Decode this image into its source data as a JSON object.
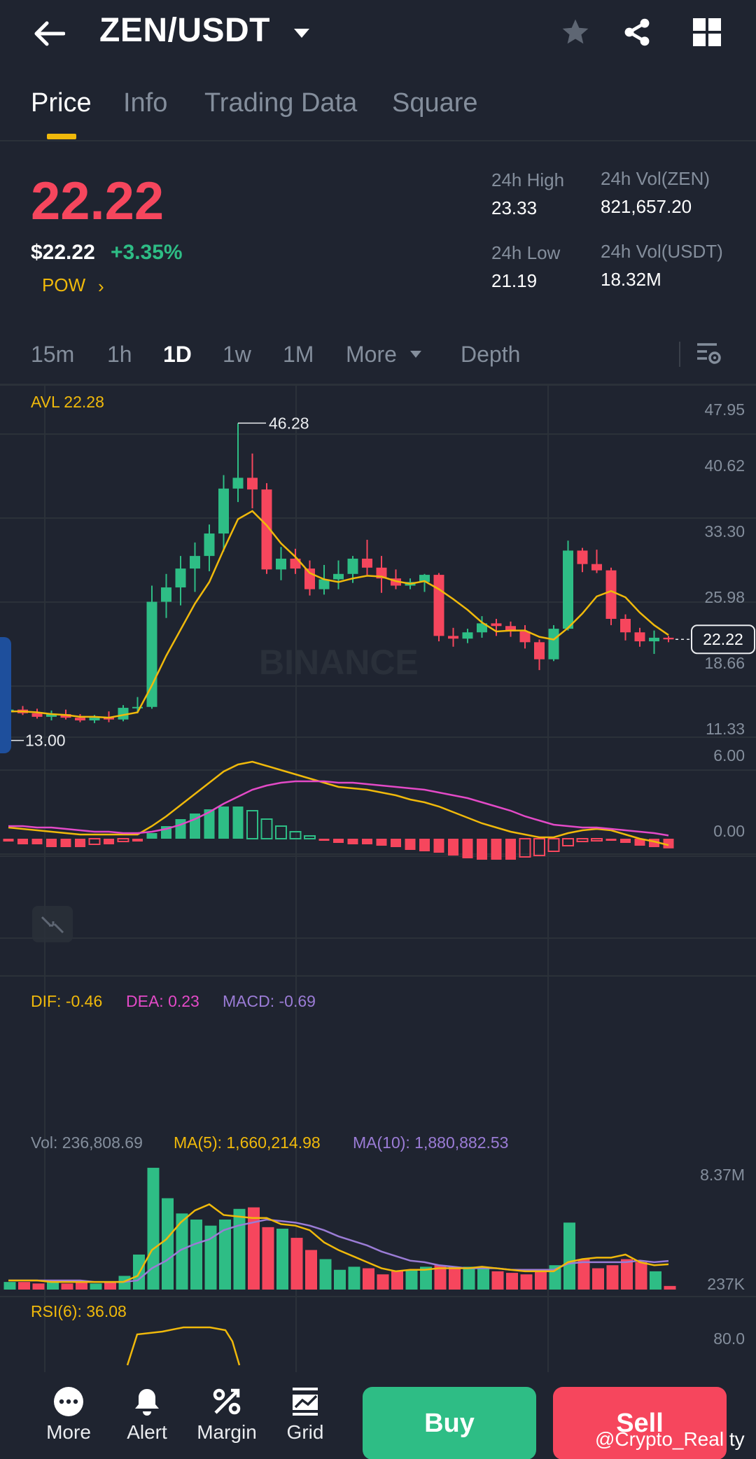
{
  "header": {
    "pair": "ZEN/USDT"
  },
  "tabs": [
    "Price",
    "Info",
    "Trading Data",
    "Square"
  ],
  "price": {
    "last": "22.22",
    "usd": "$22.22",
    "change_pct": "+3.35%",
    "tag": "POW",
    "high_label": "24h High",
    "high": "23.33",
    "low_label": "24h Low",
    "low": "21.19",
    "vol_base_label": "24h Vol(ZEN)",
    "vol_base": "821,657.20",
    "vol_quote_label": "24h Vol(USDT)",
    "vol_quote": "18.32M"
  },
  "intervals": [
    "15m",
    "1h",
    "1D",
    "1w",
    "1M",
    "More",
    "Depth"
  ],
  "chart": {
    "avl_label": "AVL 22.28",
    "y_ticks": [
      "47.95",
      "40.62",
      "33.30",
      "25.98",
      "18.66",
      "11.33"
    ],
    "max_label": "46.28",
    "min_label": "13.00",
    "current_label": "22.22",
    "watermark": "BINANCE",
    "macd": {
      "dif": "DIF: -0.46",
      "dea": "DEA: 0.23",
      "macd": "MACD: -0.69",
      "y_top": "6.00",
      "y_zero": "0.00"
    },
    "vol": {
      "vol": "Vol: 236,808.69",
      "ma5": "MA(5): 1,660,214.98",
      "ma10": "MA(10): 1,880,882.53",
      "y_top": "8.37M",
      "y_bottom": "237K"
    },
    "rsi": {
      "label": "RSI(6): 36.08",
      "y_top": "80.0"
    }
  },
  "chart_data": {
    "type": "candlestick",
    "ylim": [
      11.33,
      47.95
    ],
    "y_ticks": [
      47.95,
      40.62,
      33.3,
      25.98,
      18.66,
      11.33
    ],
    "candles": [
      {
        "o": 14.1,
        "h": 14.6,
        "l": 13.6,
        "c": 14.4
      },
      {
        "o": 14.4,
        "h": 14.8,
        "l": 13.8,
        "c": 14.0
      },
      {
        "o": 14.0,
        "h": 14.5,
        "l": 13.4,
        "c": 13.6
      },
      {
        "o": 13.6,
        "h": 14.3,
        "l": 13.2,
        "c": 13.9
      },
      {
        "o": 13.9,
        "h": 14.4,
        "l": 13.3,
        "c": 13.5
      },
      {
        "o": 13.5,
        "h": 13.9,
        "l": 13.0,
        "c": 13.2
      },
      {
        "o": 13.2,
        "h": 13.8,
        "l": 12.9,
        "c": 13.5
      },
      {
        "o": 13.5,
        "h": 14.2,
        "l": 13.0,
        "c": 13.3
      },
      {
        "o": 13.3,
        "h": 14.9,
        "l": 13.1,
        "c": 14.6
      },
      {
        "o": 14.6,
        "h": 15.8,
        "l": 14.0,
        "c": 14.7
      },
      {
        "o": 14.7,
        "h": 28.2,
        "l": 14.5,
        "c": 26.4
      },
      {
        "o": 26.4,
        "h": 29.5,
        "l": 24.6,
        "c": 28.0
      },
      {
        "o": 28.0,
        "h": 31.5,
        "l": 26.0,
        "c": 30.1
      },
      {
        "o": 30.1,
        "h": 33.0,
        "l": 27.5,
        "c": 31.5
      },
      {
        "o": 31.5,
        "h": 35.0,
        "l": 29.8,
        "c": 34.0
      },
      {
        "o": 34.0,
        "h": 40.5,
        "l": 32.0,
        "c": 39.0
      },
      {
        "o": 39.0,
        "h": 46.28,
        "l": 37.5,
        "c": 40.2
      },
      {
        "o": 40.2,
        "h": 42.9,
        "l": 36.8,
        "c": 38.9
      },
      {
        "o": 38.9,
        "h": 39.6,
        "l": 29.5,
        "c": 30.0
      },
      {
        "o": 30.0,
        "h": 32.5,
        "l": 28.8,
        "c": 31.2
      },
      {
        "o": 31.2,
        "h": 32.3,
        "l": 29.5,
        "c": 30.1
      },
      {
        "o": 30.1,
        "h": 31.0,
        "l": 27.1,
        "c": 27.8
      },
      {
        "o": 27.8,
        "h": 30.5,
        "l": 27.2,
        "c": 28.9
      },
      {
        "o": 28.9,
        "h": 31.0,
        "l": 27.8,
        "c": 29.5
      },
      {
        "o": 29.5,
        "h": 31.5,
        "l": 28.5,
        "c": 31.2
      },
      {
        "o": 31.2,
        "h": 33.3,
        "l": 29.4,
        "c": 30.2
      },
      {
        "o": 30.2,
        "h": 31.5,
        "l": 27.4,
        "c": 29.0
      },
      {
        "o": 29.0,
        "h": 30.0,
        "l": 27.8,
        "c": 28.2
      },
      {
        "o": 28.2,
        "h": 29.0,
        "l": 27.8,
        "c": 28.6
      },
      {
        "o": 28.6,
        "h": 29.5,
        "l": 27.5,
        "c": 29.4
      },
      {
        "o": 29.4,
        "h": 29.6,
        "l": 22.0,
        "c": 22.6
      },
      {
        "o": 22.6,
        "h": 23.5,
        "l": 21.4,
        "c": 22.3
      },
      {
        "o": 22.3,
        "h": 23.4,
        "l": 21.8,
        "c": 23.0
      },
      {
        "o": 23.0,
        "h": 24.8,
        "l": 22.4,
        "c": 24.0
      },
      {
        "o": 24.0,
        "h": 24.5,
        "l": 22.6,
        "c": 23.7
      },
      {
        "o": 23.7,
        "h": 24.2,
        "l": 22.5,
        "c": 23.1
      },
      {
        "o": 23.1,
        "h": 23.8,
        "l": 21.2,
        "c": 21.9
      },
      {
        "o": 21.9,
        "h": 22.2,
        "l": 18.8,
        "c": 20.0
      },
      {
        "o": 20.0,
        "h": 23.8,
        "l": 19.8,
        "c": 23.4
      },
      {
        "o": 23.4,
        "h": 33.2,
        "l": 23.2,
        "c": 32.1
      },
      {
        "o": 32.1,
        "h": 32.4,
        "l": 29.7,
        "c": 30.6
      },
      {
        "o": 30.6,
        "h": 32.2,
        "l": 29.6,
        "c": 29.9
      },
      {
        "o": 29.9,
        "h": 30.2,
        "l": 23.8,
        "c": 24.5
      },
      {
        "o": 24.5,
        "h": 25.0,
        "l": 22.1,
        "c": 23.0
      },
      {
        "o": 23.0,
        "h": 23.5,
        "l": 21.4,
        "c": 22.0
      },
      {
        "o": 22.0,
        "h": 23.2,
        "l": 20.6,
        "c": 22.4
      },
      {
        "o": 22.4,
        "h": 22.6,
        "l": 21.9,
        "c": 22.22
      }
    ],
    "ma_line": [
      14.2,
      14.2,
      14.1,
      13.9,
      13.8,
      13.6,
      13.6,
      13.5,
      13.8,
      14.1,
      17.1,
      20.4,
      23.3,
      26.2,
      28.6,
      32.2,
      35.6,
      36.5,
      34.9,
      32.9,
      31.4,
      29.6,
      28.9,
      28.6,
      29.0,
      29.3,
      29.2,
      28.7,
      28.4,
      28.7,
      27.8,
      26.7,
      25.5,
      24.1,
      23.1,
      23.2,
      23.2,
      22.5,
      22.2,
      23.5,
      25.1,
      27.0,
      27.6,
      26.9,
      25.2,
      23.8,
      22.7
    ],
    "macd": {
      "ylim": [
        -2.0,
        6.0
      ],
      "dif": [
        0.8,
        0.7,
        0.6,
        0.5,
        0.4,
        0.3,
        0.3,
        0.3,
        0.3,
        0.3,
        0.9,
        1.6,
        2.4,
        3.2,
        4.0,
        4.8,
        5.3,
        5.5,
        5.2,
        4.9,
        4.6,
        4.3,
        4.0,
        3.7,
        3.6,
        3.5,
        3.3,
        3.1,
        2.8,
        2.6,
        2.3,
        1.9,
        1.5,
        1.1,
        0.8,
        0.5,
        0.3,
        0.1,
        0.1,
        0.4,
        0.6,
        0.7,
        0.6,
        0.3,
        0.0,
        -0.2,
        -0.46
      ],
      "dea": [
        0.9,
        0.9,
        0.8,
        0.8,
        0.7,
        0.6,
        0.5,
        0.5,
        0.4,
        0.4,
        0.5,
        0.7,
        1.0,
        1.4,
        1.9,
        2.5,
        3.0,
        3.5,
        3.8,
        4.0,
        4.1,
        4.1,
        4.1,
        4.0,
        4.0,
        3.9,
        3.8,
        3.7,
        3.6,
        3.5,
        3.3,
        3.1,
        2.9,
        2.6,
        2.3,
        2.0,
        1.6,
        1.3,
        1.0,
        0.9,
        0.8,
        0.8,
        0.7,
        0.6,
        0.5,
        0.4,
        0.23
      ],
      "hist": [
        -0.2,
        -0.4,
        -0.4,
        -0.6,
        -0.6,
        -0.6,
        -0.4,
        -0.4,
        -0.2,
        -0.2,
        0.4,
        0.9,
        1.4,
        1.8,
        2.1,
        2.3,
        2.3,
        2.0,
        1.4,
        0.9,
        0.5,
        0.2,
        -0.1,
        -0.3,
        -0.4,
        -0.4,
        -0.5,
        -0.6,
        -0.8,
        -0.9,
        -1.0,
        -1.2,
        -1.4,
        -1.5,
        -1.5,
        -1.5,
        -1.3,
        -1.2,
        -0.9,
        -0.5,
        -0.2,
        -0.1,
        -0.1,
        -0.3,
        -0.5,
        -0.6,
        -0.69
      ]
    },
    "volume": {
      "ylim": [
        0,
        8.37
      ],
      "values": [
        0.5,
        0.5,
        0.4,
        0.5,
        0.4,
        0.5,
        0.4,
        0.5,
        0.9,
        2.3,
        8.0,
        6.0,
        5.0,
        4.6,
        4.2,
        4.6,
        5.3,
        5.4,
        4.1,
        4.0,
        3.4,
        2.6,
        2.0,
        1.3,
        1.5,
        1.4,
        1.0,
        1.2,
        1.3,
        1.5,
        1.6,
        1.5,
        1.5,
        1.4,
        1.2,
        1.1,
        1.0,
        1.3,
        1.6,
        4.4,
        2.0,
        1.4,
        1.6,
        2.0,
        1.8,
        1.2,
        0.237
      ],
      "ma5": [
        0.6,
        0.6,
        0.6,
        0.5,
        0.5,
        0.5,
        0.5,
        0.5,
        0.5,
        0.9,
        2.6,
        3.3,
        4.4,
        5.2,
        5.6,
        4.9,
        4.8,
        4.7,
        4.7,
        4.3,
        4.2,
        3.9,
        3.1,
        2.6,
        2.2,
        1.8,
        1.4,
        1.2,
        1.3,
        1.3,
        1.4,
        1.4,
        1.4,
        1.5,
        1.4,
        1.3,
        1.2,
        1.2,
        1.2,
        1.8,
        2.0,
        2.1,
        2.1,
        2.3,
        1.8,
        1.6,
        1.66
      ],
      "ma10": [
        0.6,
        0.6,
        0.6,
        0.6,
        0.6,
        0.6,
        0.5,
        0.5,
        0.5,
        0.6,
        1.4,
        1.9,
        2.6,
        3.0,
        3.3,
        3.9,
        4.2,
        4.4,
        4.6,
        4.5,
        4.4,
        4.2,
        3.9,
        3.5,
        3.2,
        2.9,
        2.5,
        2.2,
        1.9,
        1.8,
        1.6,
        1.5,
        1.4,
        1.4,
        1.4,
        1.3,
        1.3,
        1.3,
        1.3,
        1.7,
        1.8,
        1.8,
        1.8,
        1.8,
        1.9,
        1.8,
        1.88
      ]
    }
  },
  "bottom_bar": {
    "items": [
      "More",
      "Alert",
      "Margin",
      "Grid"
    ],
    "buy": "Buy",
    "sell": "Sell",
    "watermark": "@Crypto_Real ty"
  },
  "colors": {
    "up": "#2ebd85",
    "down": "#f6465d",
    "accent": "#f0b90b",
    "bg": "#1f2430",
    "muted": "#848e9c",
    "dea": "#e34ac7",
    "macd": "#9b7cd6"
  }
}
